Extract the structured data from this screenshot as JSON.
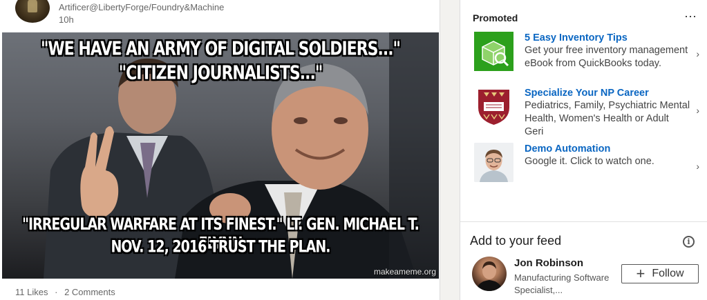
{
  "post": {
    "author": "Artificer@LibertyForge/Foundry&Machine",
    "time": "10h",
    "meme": {
      "line1": "\"WE HAVE AN ARMY OF DIGITAL SOLDIERS...\"",
      "line2": "\"CITIZEN JOURNALISTS...\"",
      "line3": "\"IRREGULAR WARFARE AT ITS FINEST.\" LT. GEN. MICHAEL T. FLYNN",
      "line4": "NOV. 12, 2016  TRUST THE PLAN.",
      "watermark": "makeameme.org"
    },
    "likes": "11 Likes",
    "separator": "·",
    "comments": "2 Comments"
  },
  "promoted": {
    "title": "Promoted",
    "more_icon": "more-horizontal-icon",
    "ads": [
      {
        "title": "5 Easy Inventory Tips",
        "description": "Get your free inventory management eBook from QuickBooks today.",
        "logo": "quickbooks-box-logo"
      },
      {
        "title": "Specialize Your NP Career",
        "description": "Pediatrics, Family, Psychiatric Mental Health, Women's Health or Adult Geri",
        "logo": "university-crest-logo"
      },
      {
        "title": "Demo Automation",
        "description": "Google it. Click to watch one.",
        "logo": "person-photo-logo"
      }
    ],
    "chevron": "›"
  },
  "feed": {
    "title": "Add to your feed",
    "info_icon": "info-icon",
    "person": {
      "name": "Jon Robinson",
      "role": "Manufacturing Software Specialist,..."
    },
    "follow_label": "Follow",
    "follow_icon": "+"
  },
  "colors": {
    "accent": "#0a66c2",
    "quickbooks": "#2ca01c",
    "crest_red": "#9c1f2e"
  }
}
